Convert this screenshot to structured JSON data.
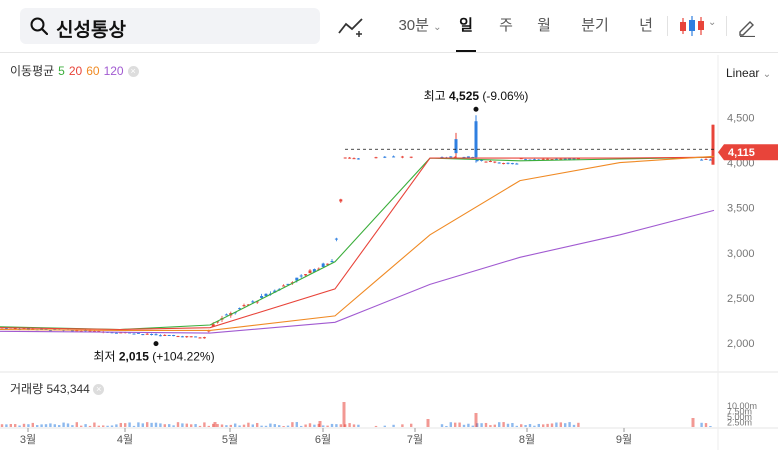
{
  "search": {
    "query": "신성통상"
  },
  "toolbar": {
    "interval_minutes": "30분",
    "periods": [
      "일",
      "주",
      "월",
      "분기",
      "년"
    ],
    "active_period": "일"
  },
  "legend": {
    "title": "이동평균",
    "ma": [
      {
        "label": "5",
        "color": "#3cae3c"
      },
      {
        "label": "20",
        "color": "#e8443a"
      },
      {
        "label": "60",
        "color": "#f08a24"
      },
      {
        "label": "120",
        "color": "#a15ad1"
      }
    ]
  },
  "scale_label": "Linear",
  "volume": {
    "label": "거래량",
    "value": "543,344"
  },
  "colors": {
    "up": "#e8443a",
    "down": "#2f7fe0",
    "current_tag": "#e8443a"
  },
  "chart_data": {
    "type": "candlestick",
    "yaxis": {
      "ticks": [
        "2,000",
        "2,500",
        "3,000",
        "3,500",
        "4,000",
        "4,500"
      ],
      "values": [
        2000,
        2500,
        3000,
        3500,
        4000,
        4500
      ],
      "ylim": [
        1820,
        4760
      ]
    },
    "xaxis": {
      "ticks": [
        "3월",
        "4월",
        "5월",
        "6월",
        "7월",
        "8월",
        "9월"
      ]
    },
    "current_price": {
      "label": "4,115",
      "value": 4115
    },
    "annotations": {
      "high": {
        "prefix": "최고",
        "value": "4,525",
        "change": "(-9.06%)",
        "price": 4525
      },
      "low": {
        "prefix": "최저",
        "value": "2,015",
        "change": "(+104.22%)",
        "price": 2015
      }
    },
    "series": [
      {
        "name": "5",
        "values_at_ticks": [
          2180,
          2150,
          2200,
          2900,
          4050,
          4020,
          4040,
          4060
        ]
      },
      {
        "name": "20",
        "values_at_ticks": [
          2170,
          2150,
          2170,
          2600,
          4050,
          4050,
          4050,
          4060
        ]
      },
      {
        "name": "60",
        "values_at_ticks": [
          2150,
          2140,
          2140,
          2300,
          3200,
          3800,
          4000,
          4070
        ]
      },
      {
        "name": "120",
        "values_at_ticks": [
          2130,
          2120,
          2110,
          2230,
          2650,
          2950,
          3200,
          3470
        ]
      }
    ],
    "volume_axis": {
      "ticks": [
        "10.00m",
        "7.50m",
        "5.00m",
        "2.50m"
      ]
    }
  }
}
